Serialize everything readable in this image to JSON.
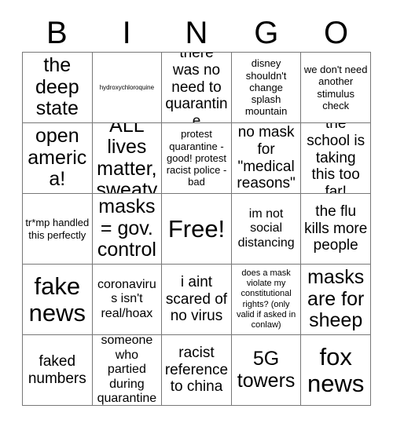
{
  "header": {
    "letters": [
      "B",
      "I",
      "N",
      "G",
      "O"
    ]
  },
  "grid": {
    "columns": 5,
    "rows": 5,
    "border_color": "#777777",
    "background_color": "#ffffff",
    "text_color": "#000000",
    "cells": [
      {
        "text": "the deep state",
        "size": "xl"
      },
      {
        "text": "hydroxychloroquine",
        "size": "tiny"
      },
      {
        "text": "there was no need to quarantine",
        "size": "lg"
      },
      {
        "text": "disney shouldn't change splash mountain",
        "size": "sm"
      },
      {
        "text": "we don't need another stimulus check",
        "size": "sm"
      },
      {
        "text": "open america!",
        "size": "xl"
      },
      {
        "text": "ALL lives matter, sweaty",
        "size": "xl"
      },
      {
        "text": "protest quarantine - good! protest racist police - bad",
        "size": "sm"
      },
      {
        "text": "no mask for \"medical reasons\"",
        "size": "lg"
      },
      {
        "text": "the school is taking this too far!",
        "size": "lg"
      },
      {
        "text": "tr*mp handled this perfectly",
        "size": "sm"
      },
      {
        "text": "masks = gov. control",
        "size": "xl"
      },
      {
        "text": "Free!",
        "size": "xxl"
      },
      {
        "text": "im not social distancing",
        "size": "md"
      },
      {
        "text": "the flu kills more people",
        "size": "lg"
      },
      {
        "text": "fake news",
        "size": "xxl"
      },
      {
        "text": "coronavirus isn't real/hoax",
        "size": "md"
      },
      {
        "text": "i aint scared of no virus",
        "size": "lg"
      },
      {
        "text": "does a mask violate my constitutional rights? (only valid if asked in conlaw)",
        "size": "xs"
      },
      {
        "text": "masks are for sheep",
        "size": "xl"
      },
      {
        "text": "faked numbers",
        "size": "lg"
      },
      {
        "text": "someone who partied during quarantine",
        "size": "md"
      },
      {
        "text": "racist reference to china",
        "size": "lg"
      },
      {
        "text": "5G towers",
        "size": "xl"
      },
      {
        "text": "fox news",
        "size": "xxl"
      }
    ]
  }
}
